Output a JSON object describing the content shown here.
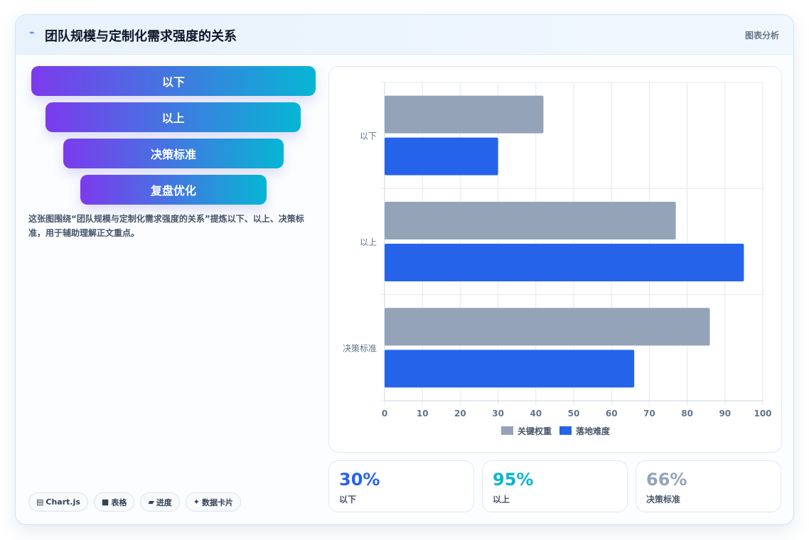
{
  "header": {
    "icon": "pulse-icon",
    "title": "团队规模与定制化需求强度的关系",
    "right_label": "图表分析"
  },
  "funnel": [
    "以下",
    "以上",
    "决策标准",
    "复盘优化"
  ],
  "description": "这张图围绕“团队规模与定制化需求强度的关系”提炼以下、以上、决策标准，用于辅助理解正文重点。",
  "chips": [
    {
      "icon": "▤",
      "label": "Chart.js"
    },
    {
      "icon": "■",
      "label": "表格"
    },
    {
      "icon": "▰",
      "label": "进度"
    },
    {
      "icon": "✦",
      "label": "数据卡片"
    }
  ],
  "stats": [
    {
      "value": "30%",
      "label": "以下",
      "color": "#2563eb"
    },
    {
      "value": "95%",
      "label": "以上",
      "color": "#06b6d4"
    },
    {
      "value": "66%",
      "label": "决策标准",
      "color": "#94a3b8"
    }
  ],
  "chart_data": {
    "type": "bar",
    "orientation": "horizontal",
    "categories": [
      "以下",
      "以上",
      "决策标准"
    ],
    "series": [
      {
        "name": "关键权重",
        "values": [
          42,
          77,
          86
        ],
        "color": "#94a3b8"
      },
      {
        "name": "落地难度",
        "values": [
          30,
          95,
          66
        ],
        "color": "#2563eb"
      }
    ],
    "xlim": [
      0,
      100
    ],
    "xticks": [
      0,
      10,
      20,
      30,
      40,
      50,
      60,
      70,
      80,
      90,
      100
    ],
    "grid": true,
    "legend": "bottom"
  }
}
